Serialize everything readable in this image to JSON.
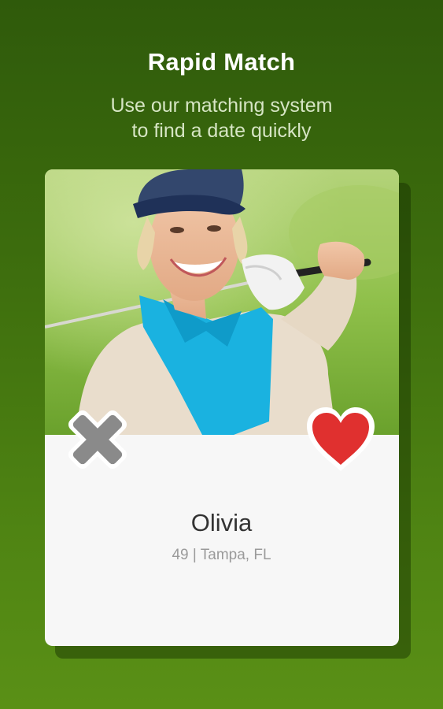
{
  "header": {
    "title": "Rapid Match",
    "subtitle_line1": "Use our matching system",
    "subtitle_line2": "to find a date quickly"
  },
  "profile": {
    "name": "Olivia",
    "meta": "49 | Tampa, FL",
    "photo_subject": "smiling woman in blue cap holding golf club"
  },
  "actions": {
    "dislike_icon": "close-x-icon",
    "like_icon": "heart-icon"
  },
  "colors": {
    "background": "#3c6c0d",
    "dislike": "#8a8a8a",
    "like": "#e0302f",
    "card": "#f7f7f7"
  }
}
